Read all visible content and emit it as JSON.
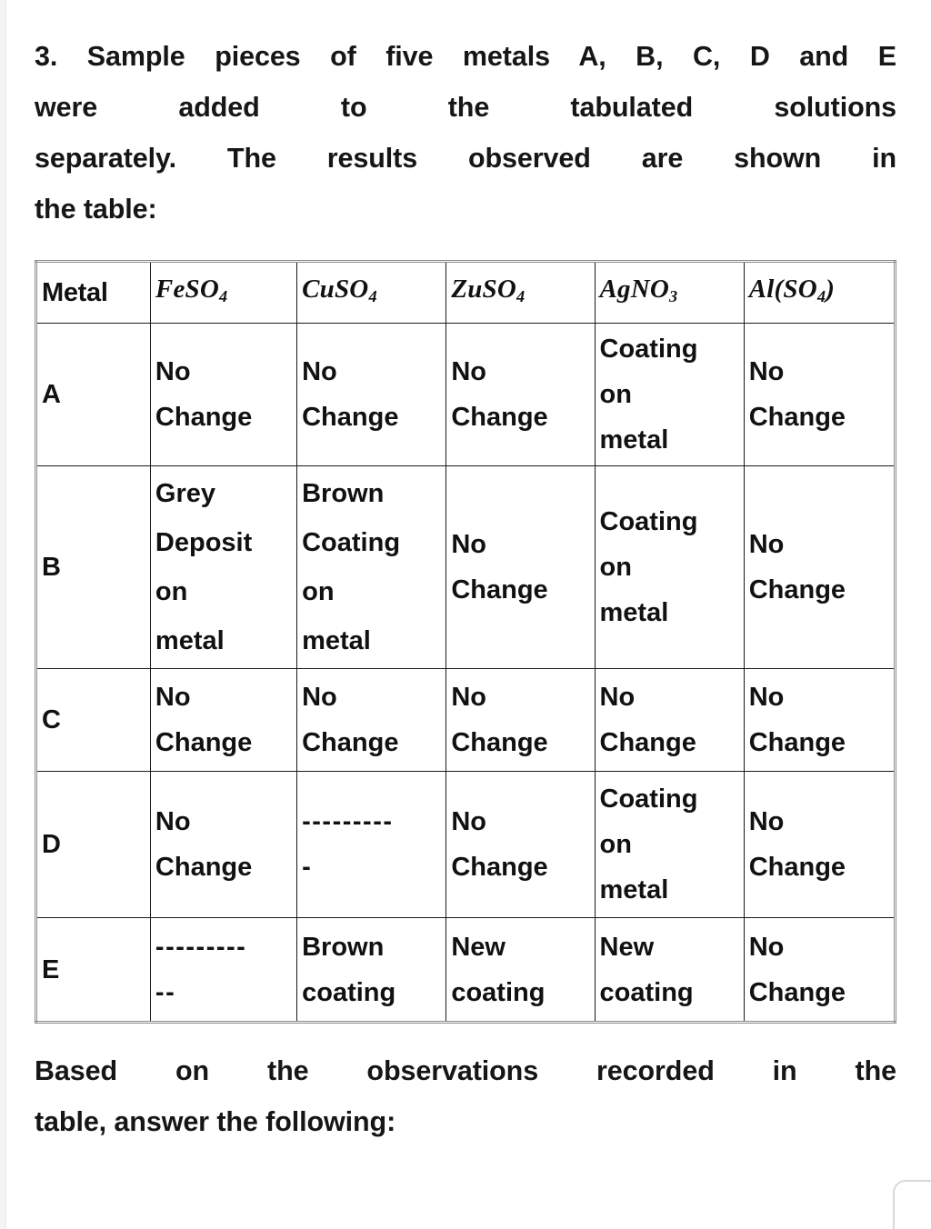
{
  "question": {
    "intro_lines": [
      "3. Sample pieces of five metals A, B, C, D and E",
      "were added to the tabulated solutions",
      "separately. The results observed are shown in",
      "the table:"
    ],
    "outro_lines": [
      "Based on the observations recorded in the",
      "table, answer the following:"
    ]
  },
  "table": {
    "headers": [
      {
        "label": "Metal",
        "style": "sans"
      },
      {
        "label": "FeSO",
        "sub": "4",
        "style": "formula"
      },
      {
        "label": "CuSO",
        "sub": "4",
        "style": "formula"
      },
      {
        "label": "ZuSO",
        "sub": "4",
        "style": "formula"
      },
      {
        "label": "AgNO",
        "sub": "3",
        "style": "formula"
      },
      {
        "label": "Al(SO",
        "sub": "4",
        "suffix": ")",
        "style": "formula"
      }
    ],
    "rows": [
      {
        "metal": "A",
        "cells": [
          "No\nChange",
          "No\nChange",
          "No\nChange",
          "Coating\non\nmetal",
          "No\nChange"
        ]
      },
      {
        "metal": "B",
        "cells": [
          "Grey\nDeposit\non\nmetal",
          "Brown\nCoating\non\nmetal",
          "No\nChange",
          "Coating\non\nmetal",
          "No\nChange"
        ]
      },
      {
        "metal": "C",
        "cells": [
          "No\nChange",
          "No\nChange",
          "No\nChange",
          "No\nChange",
          "No\nChange"
        ]
      },
      {
        "metal": "D",
        "cells": [
          "No\nChange",
          "---------\n-",
          "No\nChange",
          "Coating\non\nmetal",
          "No\nChange"
        ]
      },
      {
        "metal": "E",
        "cells": [
          "---------\n--",
          "Brown\ncoating",
          "New\ncoating",
          "New\ncoating",
          "No\nChange"
        ]
      }
    ]
  }
}
